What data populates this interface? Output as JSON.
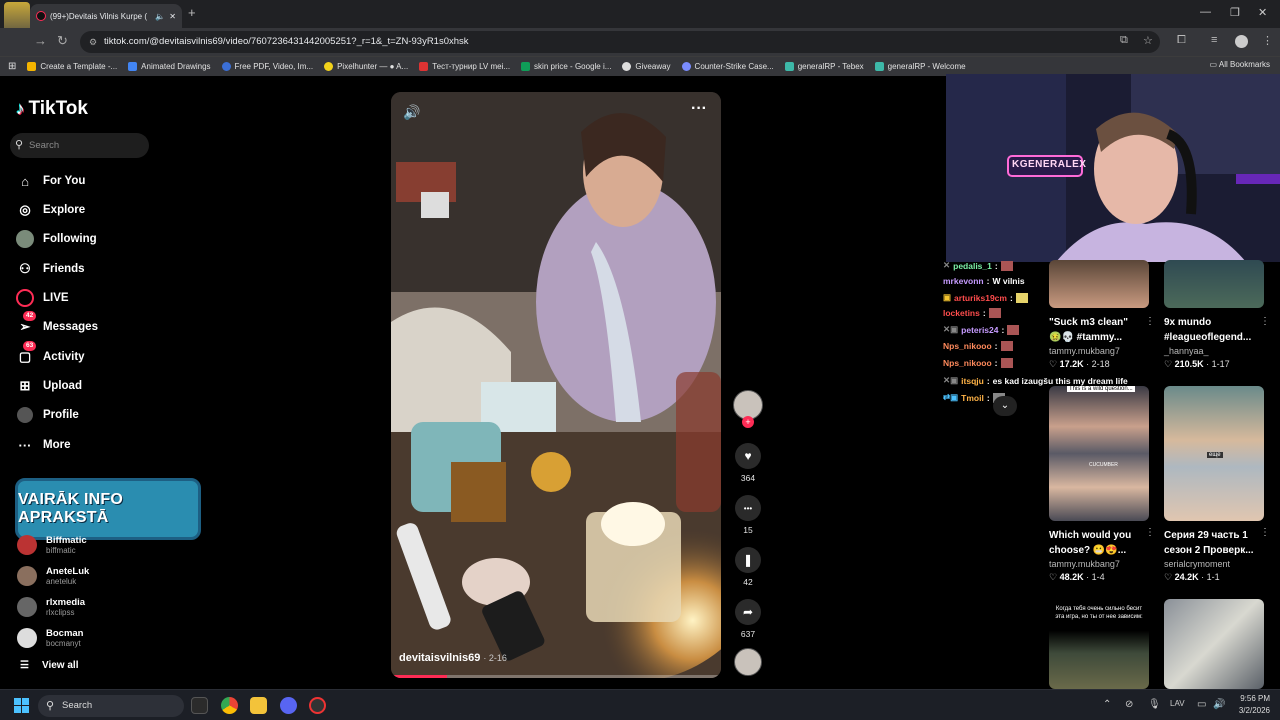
{
  "browser": {
    "tab_title": "(99+)Devitais Vilnis Kurpe (",
    "new_tab": "+",
    "url": "tiktok.com/@devitaisvilnis69/video/7607236431442005251?_r=1&_t=ZN-93yR1s0xhsk",
    "bookmarks": [
      {
        "label": "Create a Template -...",
        "color": "#f4b400"
      },
      {
        "label": "Animated Drawings",
        "color": "#4285f4"
      },
      {
        "label": "Free PDF, Video, Im...",
        "color": "#3b6fd6"
      },
      {
        "label": "Pixelhunter — ● A...",
        "color": "#f2d21b"
      },
      {
        "label": "Тест-турнир LV mei...",
        "color": "#d33"
      },
      {
        "label": "skin price - Google i...",
        "color": "#0f9d58"
      },
      {
        "label": "Giveaway",
        "color": "#ddd"
      },
      {
        "label": "Counter-Strike Case...",
        "color": "#7a8cff"
      },
      {
        "label": "generalRP - Tebex",
        "color": "#3db8a8"
      },
      {
        "label": "generalRP - Welcome",
        "color": "#3db8a8"
      }
    ],
    "all_bookmarks": "All Bookmarks"
  },
  "tiktok": {
    "logo": "TikTok",
    "search_placeholder": "Search",
    "nav": [
      {
        "label": "For You",
        "icon": "home-icon"
      },
      {
        "label": "Explore",
        "icon": "compass-icon"
      },
      {
        "label": "Following",
        "icon": "following-avatar-icon"
      },
      {
        "label": "Friends",
        "icon": "friends-icon"
      },
      {
        "label": "LIVE",
        "icon": "live-icon"
      },
      {
        "label": "Messages",
        "icon": "messages-icon",
        "badge": "42"
      },
      {
        "label": "Activity",
        "icon": "activity-icon",
        "badge": "63"
      },
      {
        "label": "Upload",
        "icon": "upload-icon"
      },
      {
        "label": "Profile",
        "icon": "profile-avatar-icon"
      },
      {
        "label": "More",
        "icon": "more-icon"
      }
    ],
    "overlay_banner": "VAIRĀK INFO APRAKSTĀ",
    "following_accounts": [
      {
        "name": "Biffmatic",
        "handle": "biffmatic",
        "color": "#b33"
      },
      {
        "name": "AneteLuk",
        "handle": "aneteluk",
        "color": "#8a6f5e"
      },
      {
        "name": "rlxmedia",
        "handle": "rlxclipss",
        "color": "#666"
      },
      {
        "name": "Bocman",
        "handle": "bocmanyt",
        "color": "#ddd"
      }
    ],
    "view_all": "View all",
    "video": {
      "author": "devitaisvilnis69",
      "date": "· 2-16",
      "progress": 0.17
    },
    "actions": [
      {
        "name": "like",
        "icon": "heart-icon",
        "glyph": "♥",
        "count": "364"
      },
      {
        "name": "comment",
        "icon": "comment-icon",
        "glyph": "•••",
        "count": "15"
      },
      {
        "name": "save",
        "icon": "bookmark-icon",
        "glyph": "❚",
        "count": "42"
      },
      {
        "name": "share",
        "icon": "share-icon",
        "glyph": "➦",
        "count": "637"
      }
    ],
    "suggested": [
      {
        "title": "\"Suck m3 clean\"",
        "title2": "🤢💀 #tammy...",
        "account": "tammy.mukbang7",
        "likes": "17.2K",
        "date": "2-18"
      },
      {
        "title": "9x mundo",
        "title2": "#leagueoflegend...",
        "account": "_hannyaa_",
        "likes": "210.5K",
        "date": "1-17"
      },
      {
        "title": "Which would you",
        "title2": "choose? 😬😍...",
        "account": "tammy.mukbang7",
        "likes": "48.2K",
        "date": "1-4"
      },
      {
        "title": "Серия 29 часть 1",
        "title2": "сезон 2 Проверк...",
        "account": "serialcrymoment",
        "likes": "24.2K",
        "date": "1-1"
      }
    ],
    "thumb_captions": {
      "q": "This is a wild question...",
      "cucumber": "CUCUMBER",
      "eshche": "еще",
      "ru": "Когда тебя очень сильно бесит эта игра, но ты от нее зависим:"
    }
  },
  "stream": {
    "cam_sign": "KGENERALEX",
    "chat": [
      {
        "user": "pedalis_1",
        "msg": "",
        "color": "#7cf2a8"
      },
      {
        "user": "mrkevonn",
        "msg": "W vilnis",
        "color": "#c69bff"
      },
      {
        "user": "arturiks19cm",
        "msg": "",
        "color": "#ff4d4d"
      },
      {
        "user": "locketins",
        "msg": "",
        "color": "#ff4d4d"
      },
      {
        "user": "peteris24",
        "msg": "",
        "color": "#c69bff"
      },
      {
        "user": "Nps_nikooo",
        "msg": "",
        "color": "#ff8a5c"
      },
      {
        "user": "Nps_nikooo",
        "msg": "",
        "color": "#ff8a5c"
      },
      {
        "user": "itsqju",
        "msg": "es kad izaugšu this my dream life",
        "color": "#ffb347"
      },
      {
        "user": "Tmoil",
        "msg": "",
        "color": "#ffb347"
      }
    ]
  },
  "taskbar": {
    "search": "Search",
    "lang": "LAV",
    "time": "9:56 PM",
    "date": "3/2/2026"
  }
}
